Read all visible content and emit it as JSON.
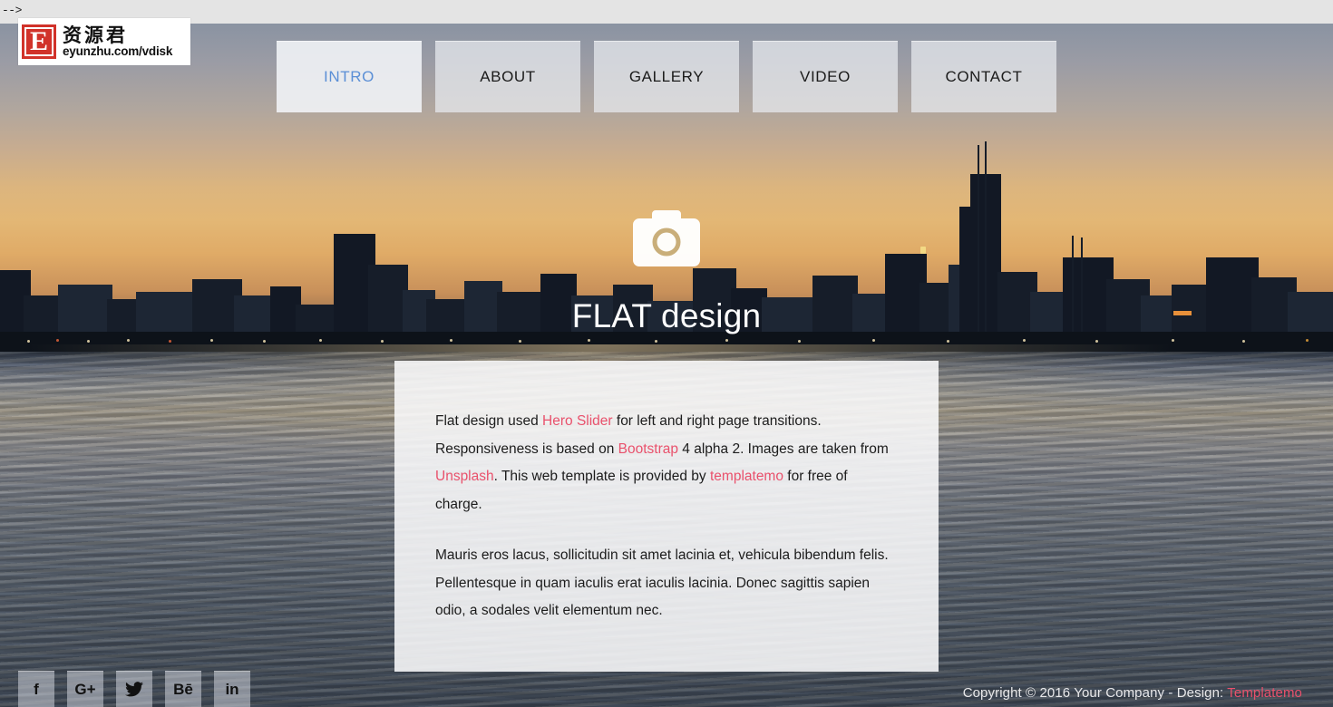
{
  "artifact": {
    "text": "-->"
  },
  "watermark": {
    "badge_letter": "E",
    "cn_name": "资源君",
    "url": "eyunzhu.com/vdisk"
  },
  "nav": {
    "items": [
      {
        "label": "INTRO",
        "active": true
      },
      {
        "label": "ABOUT",
        "active": false
      },
      {
        "label": "GALLERY",
        "active": false
      },
      {
        "label": "VIDEO",
        "active": false
      },
      {
        "label": "CONTACT",
        "active": false
      }
    ]
  },
  "hero": {
    "icon": "camera-icon",
    "title": "FLAT design"
  },
  "content": {
    "paragraph1": {
      "seg1": "Flat design used ",
      "link1": "Hero Slider",
      "seg2": " for left and right page transitions. Responsiveness is based on ",
      "link2": "Bootstrap",
      "seg3": " 4 alpha 2. Images are taken from ",
      "link3": "Unsplash",
      "seg4": ". This web template is provided by ",
      "link4": "templatemo",
      "seg5": " for free of charge."
    },
    "paragraph2": "Mauris eros lacus, sollicitudin sit amet lacinia et, vehicula bibendum felis. Pellentesque in quam iaculis erat iaculis lacinia. Donec sagittis sapien odio, a sodales velit elementum nec."
  },
  "footer": {
    "social": [
      {
        "name": "facebook-icon",
        "glyph": "f"
      },
      {
        "name": "google-plus-icon",
        "glyph": "G+"
      },
      {
        "name": "twitter-icon",
        "glyph": ""
      },
      {
        "name": "behance-icon",
        "glyph": "Bē"
      },
      {
        "name": "linkedin-icon",
        "glyph": "in"
      }
    ],
    "copyright_text": "Copyright © 2016 Your Company - Design: ",
    "copyright_link": "Templatemo"
  },
  "colors": {
    "link_pink": "#e9516c",
    "active_tab_text": "#5b8fd6",
    "panel_bg": "rgba(250,250,252,0.88)"
  }
}
